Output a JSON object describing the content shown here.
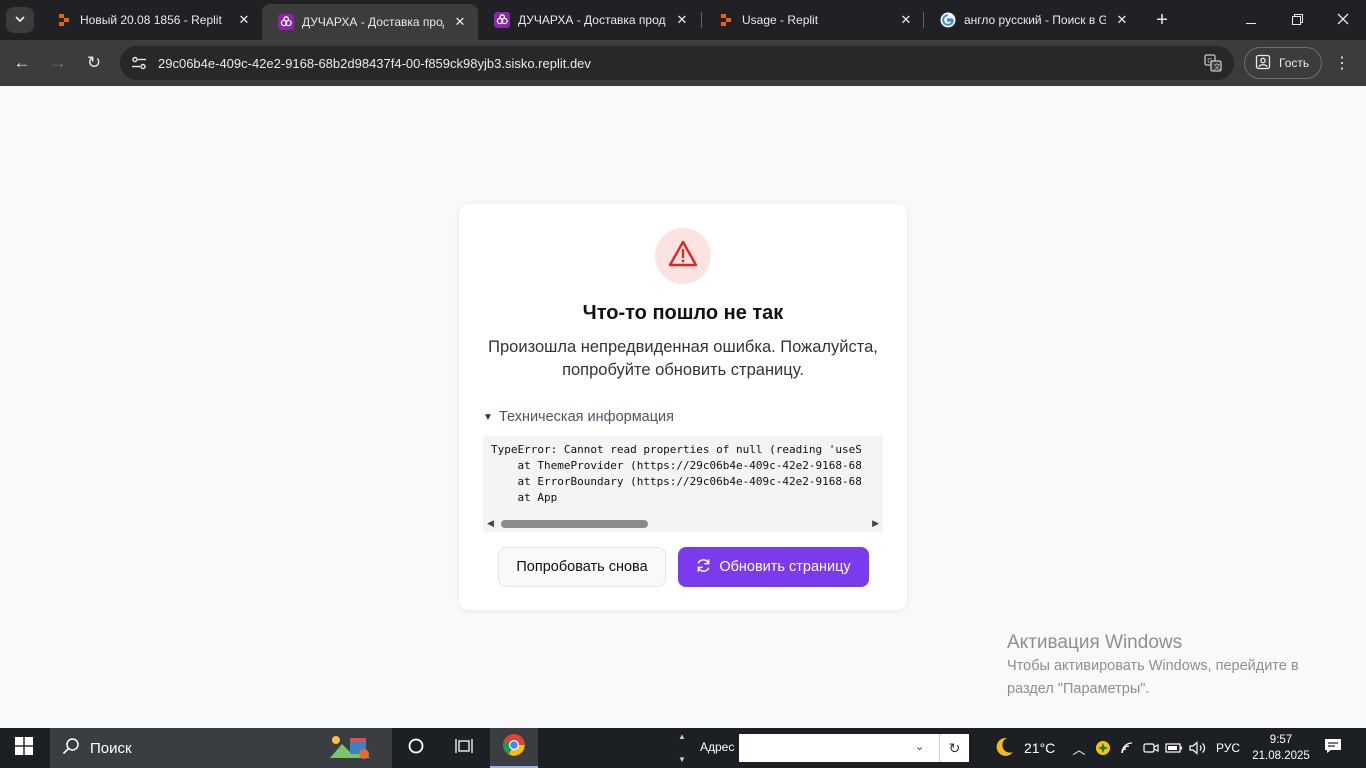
{
  "browser": {
    "tab_search_icon": "chevron-down-icon",
    "tabs": [
      {
        "title": "Новый 20.08 1856 - Replit",
        "favicon": "replit-icon",
        "active": false
      },
      {
        "title": "ДУЧАРХА - Доставка продук",
        "favicon": "app-icon",
        "active": true
      },
      {
        "title": "ДУЧАРХА - Доставка продук",
        "favicon": "app-icon",
        "active": false
      },
      {
        "title": "Usage - Replit",
        "favicon": "replit-icon",
        "active": false
      },
      {
        "title": "англо русский - Поиск в G",
        "favicon": "google-icon",
        "active": false
      }
    ],
    "url": "29c06b4e-409c-42e2-9168-68b2d98437f4-00-f859ck98yjb3.sisko.replit.dev",
    "profile_label": "Гость"
  },
  "page": {
    "title": "Что-то пошло не так",
    "message": "Произошла непредвиденная ошибка. Пожалуйста, попробуйте обновить страницу.",
    "details_summary": "Техническая информация",
    "stack_trace": "TypeError: Cannot read properties of null (reading 'useS\n    at ThemeProvider (https://29c06b4e-409c-42e2-9168-68\n    at ErrorBoundary (https://29c06b4e-409c-42e2-9168-68\n    at App",
    "retry_button": "Попробовать снова",
    "reload_button": "Обновить страницу",
    "accent_color": "#7c3aed",
    "error_color": "#dc2626"
  },
  "windows_activation": {
    "title": "Активация Windows",
    "line1": "Чтобы активировать Windows, перейдите в",
    "line2": "раздел \"Параметры\"."
  },
  "taskbar": {
    "search_placeholder": "Поиск",
    "address_label": "Адрес",
    "address_value": "",
    "temperature": "21°C",
    "language": "РУС",
    "time": "9:57",
    "date": "21.08.2025"
  }
}
